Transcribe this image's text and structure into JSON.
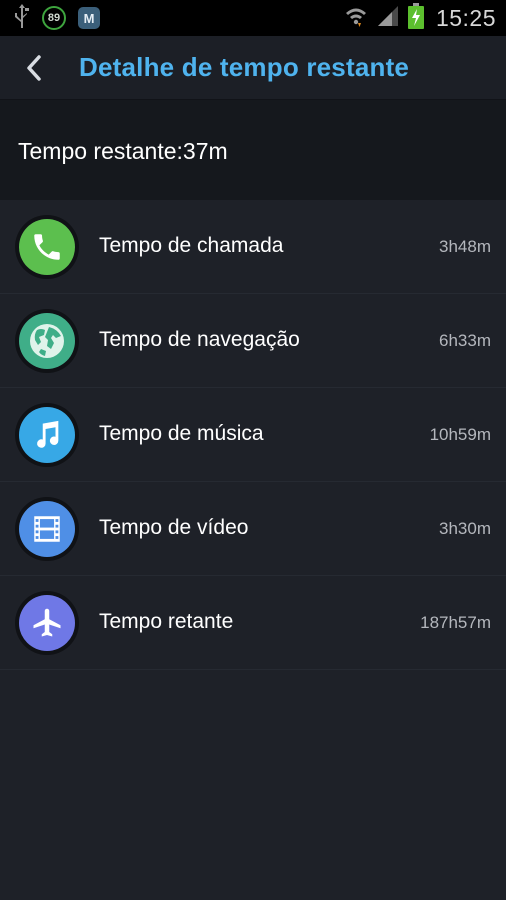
{
  "status_bar": {
    "time": "15:25",
    "notification_badge": "89",
    "app_badge": "M",
    "icons": [
      "usb-icon",
      "battery-saver-icon",
      "app-icon",
      "wifi-icon",
      "signal-icon",
      "battery-charging-icon"
    ]
  },
  "header": {
    "title": "Detalhe de tempo restante",
    "back_icon": "chevron-left-icon"
  },
  "summary": {
    "text": "Tempo restante:37m"
  },
  "items": [
    {
      "label": "Tempo de chamada",
      "value": "3h48m",
      "icon": "phone-icon",
      "color": "#5cbf4e"
    },
    {
      "label": "Tempo de navegação",
      "value": "6h33m",
      "icon": "globe-icon",
      "color": "#3fae88"
    },
    {
      "label": "Tempo de música",
      "value": "10h59m",
      "icon": "music-note-icon",
      "color": "#37a8e6"
    },
    {
      "label": "Tempo de vídeo",
      "value": "3h30m",
      "icon": "film-icon",
      "color": "#4f8fe6"
    },
    {
      "label": "Tempo retante",
      "value": "187h57m",
      "icon": "airplane-icon",
      "color": "#6f78e6"
    }
  ],
  "colors": {
    "accent": "#4fb3ee",
    "background": "#1e2128",
    "summary_background": "#15181d"
  }
}
